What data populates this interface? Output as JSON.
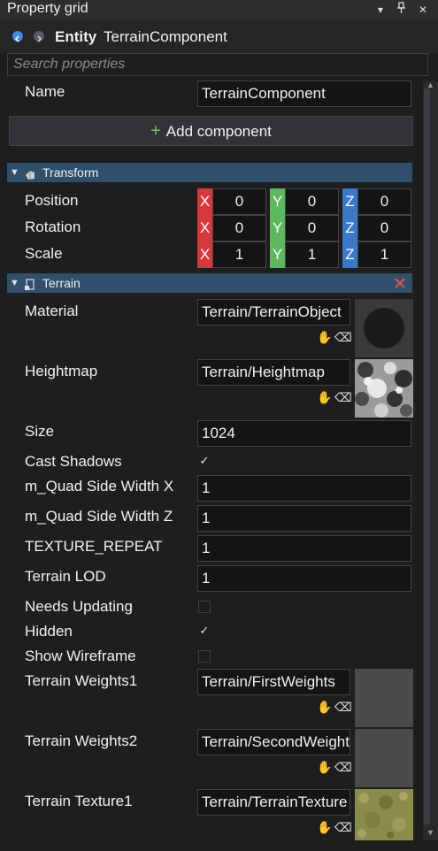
{
  "panel": {
    "title": "Property grid",
    "dropdown_icon": "▾",
    "pin_icon": "pin",
    "close_icon": "✕"
  },
  "entity": {
    "label": "Entity",
    "name": "TerrainComponent"
  },
  "search": {
    "placeholder": "Search properties",
    "value": ""
  },
  "name_row": {
    "label": "Name",
    "value": "TerrainComponent"
  },
  "add_component": {
    "plus": "+",
    "label": "Add component"
  },
  "transform": {
    "title": "Transform",
    "axis_labels": {
      "x": "X",
      "y": "Y",
      "z": "Z"
    },
    "rows": [
      {
        "label": "Position",
        "x": "0",
        "y": "0",
        "z": "0"
      },
      {
        "label": "Rotation",
        "x": "0",
        "y": "0",
        "z": "0"
      },
      {
        "label": "Scale",
        "x": "1",
        "y": "1",
        "z": "1"
      }
    ]
  },
  "terrain": {
    "title": "Terrain",
    "material": {
      "label": "Material",
      "value": "Terrain/TerrainObject"
    },
    "heightmap": {
      "label": "Heightmap",
      "value": "Terrain/Heightmap"
    },
    "size": {
      "label": "Size",
      "value": "1024"
    },
    "cast_shadows": {
      "label": "Cast Shadows",
      "checked": true,
      "mark": "✓"
    },
    "quad_x": {
      "label": "m_Quad Side Width X",
      "value": "1"
    },
    "quad_z": {
      "label": "m_Quad Side Width Z",
      "value": "1"
    },
    "texture_repeat": {
      "label": "TEXTURE_REPEAT",
      "value": "1"
    },
    "terrain_lod": {
      "label": "Terrain LOD",
      "value": "1"
    },
    "needs_updating": {
      "label": "Needs Updating",
      "checked": false,
      "mark": ""
    },
    "hidden": {
      "label": "Hidden",
      "checked": true,
      "mark": "✓"
    },
    "show_wireframe": {
      "label": "Show Wireframe",
      "checked": false,
      "mark": ""
    },
    "weights1": {
      "label": "Terrain Weights1",
      "value": "Terrain/FirstWeights"
    },
    "weights2": {
      "label": "Terrain Weights2",
      "value": "Terrain/SecondWeights"
    },
    "texture1": {
      "label": "Terrain Texture1",
      "value": "Terrain/TerrainTexture"
    }
  },
  "colors": {
    "section": "#2f4f6a",
    "x_axis": "#d9383a",
    "y_axis": "#5cb85c",
    "z_axis": "#3a78c9",
    "remove": "#e05050"
  }
}
